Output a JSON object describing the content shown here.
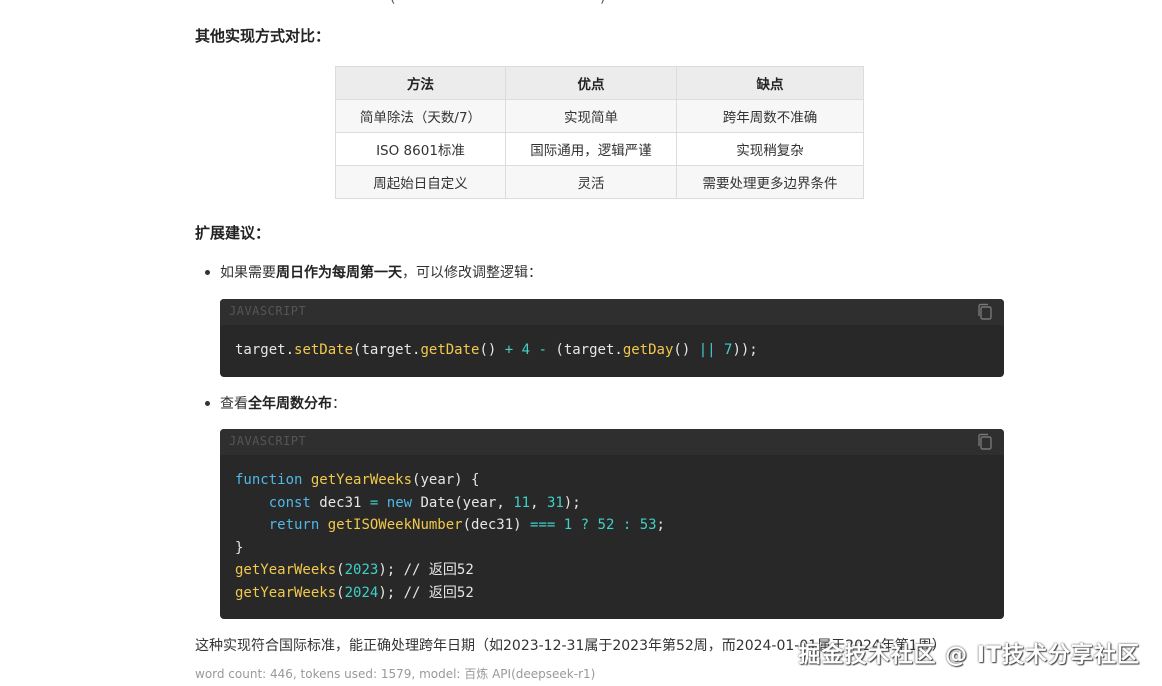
{
  "top_fragment": {
    "left_paren": "(",
    "right_paren": ")"
  },
  "compare_heading": "其他实现方式对比：",
  "table": {
    "headers": [
      "方法",
      "优点",
      "缺点"
    ],
    "rows": [
      [
        "简单除法（天数/7）",
        "实现简单",
        "跨年周数不准确"
      ],
      [
        "ISO 8601标准",
        "国际通用，逻辑严谨",
        "实现稍复杂"
      ],
      [
        "周起始日自定义",
        "灵活",
        "需要处理更多边界条件"
      ]
    ]
  },
  "ext_heading": "扩展建议：",
  "bullet1": {
    "prefix": "如果需要",
    "bold": "周日作为每周第一天",
    "suffix": "，可以修改调整逻辑："
  },
  "bullet2": {
    "prefix": "查看",
    "bold": "全年周数分布",
    "suffix": "："
  },
  "code1": {
    "lang": "JAVASCRIPT",
    "copy_icon": "copy-icon",
    "t": {
      "a": "target.",
      "b": "setDate",
      "c": "(target.",
      "d": "getDate",
      "e": "() ",
      "f": "+",
      "g": " ",
      "h": "4",
      "i": " ",
      "j": "-",
      "k": " (target.",
      "l": "getDay",
      "m": "() ",
      "n": "||",
      "o": " ",
      "p": "7",
      "q": "));"
    }
  },
  "code2": {
    "lang": "JAVASCRIPT",
    "copy_icon": "copy-icon",
    "l1": {
      "kw": "function",
      "fn": "getYearWeeks",
      "rest": "(year) {"
    },
    "l2": {
      "indent": "    ",
      "kw": "const",
      "a": " dec31 ",
      "op": "=",
      "sp": " ",
      "kw2": "new",
      "b": " Date(year, ",
      "n1": "11",
      "c": ", ",
      "n2": "31",
      "d": ");"
    },
    "l3": {
      "indent": "    ",
      "kw": "return",
      "sp": " ",
      "fn": "getISOWeekNumber",
      "a": "(dec31) ",
      "op": "===",
      "sp2": " ",
      "n1": "1",
      "sp3": " ",
      "op2": "?",
      "sp4": " ",
      "n2": "52",
      "sp5": " ",
      "op3": ":",
      "sp6": " ",
      "n3": "53",
      "e": ";"
    },
    "l4": "}",
    "l5": {
      "fn": "getYearWeeks",
      "a": "(",
      "n": "2023",
      "b": "); ",
      "cm": "// 返回52"
    },
    "l6": {
      "fn": "getYearWeeks",
      "a": "(",
      "n": "2024",
      "b": "); ",
      "cm": "// 返回52"
    }
  },
  "conclusion": "这种实现符合国际标准，能正确处理跨年日期（如2023-12-31属于2023年第52周，而2024-01-01属于2024年第1周）",
  "meta": "word count: 446, tokens used: 1579, model: 百炼 API(deepseek-r1)",
  "watermark": "掘金技术社区 @ IT技术分享社区",
  "colors": {
    "code_bg": "#282828",
    "keyword": "#4fb8e8",
    "function": "#f2c94c",
    "number": "#3fd0c7"
  }
}
